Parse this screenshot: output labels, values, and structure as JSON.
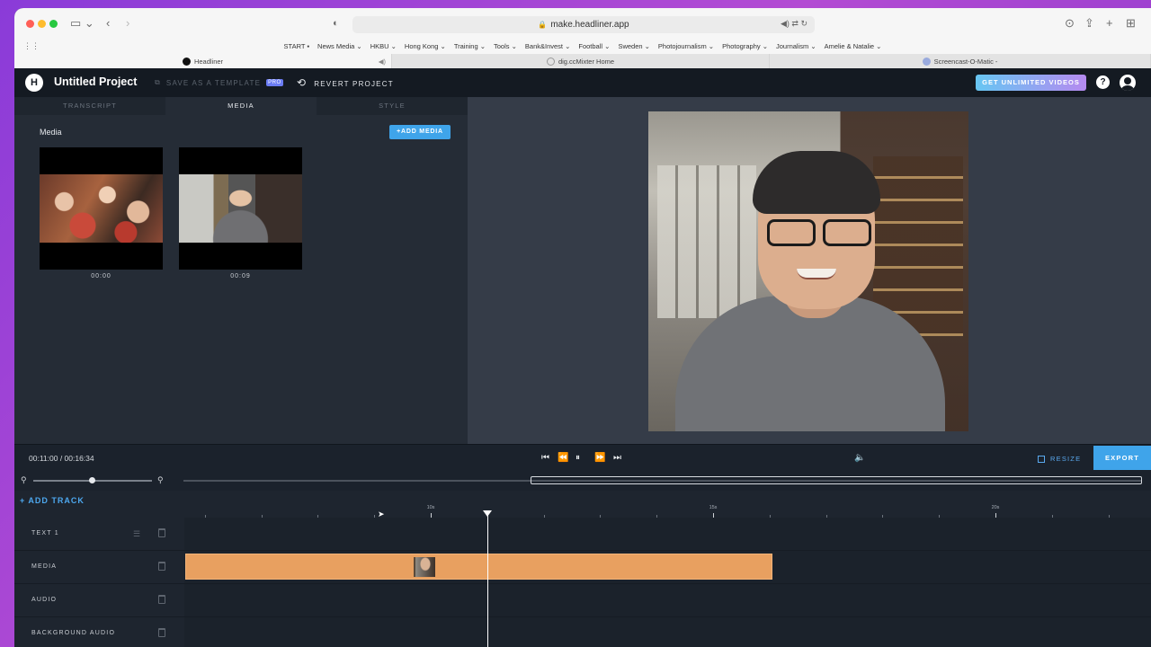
{
  "browser": {
    "url": "make.headliner.app",
    "favorites": [
      "START ▪",
      "News Media ⌄",
      "HKBU ⌄",
      "Hong Kong ⌄",
      "Training ⌄",
      "Tools ⌄",
      "Bank&Invest ⌄",
      "Football ⌄",
      "Sweden ⌄",
      "Photojournalism ⌄",
      "Photography ⌄",
      "Journalism ⌄",
      "Amelie & Natalie ⌄"
    ],
    "tabs": [
      {
        "label": "Headliner",
        "active": true
      },
      {
        "label": "dig.ccMixter Home",
        "active": false
      },
      {
        "label": "Screencast-O-Matic -",
        "active": false
      }
    ]
  },
  "app": {
    "logo_letter": "H",
    "project_title": "Untitled Project",
    "save_template_label": "SAVE AS A TEMPLATE",
    "pro_badge": "PRO",
    "revert_label": "REVERT PROJECT",
    "get_unlimited_label": "GET UNLIMITED VIDEOS",
    "help_label": "?"
  },
  "panel": {
    "tabs": [
      "TRANSCRIPT",
      "MEDIA",
      "STYLE"
    ],
    "active_tab": "MEDIA",
    "media_heading": "Media",
    "add_media_label": "+ADD MEDIA",
    "thumbnails": [
      {
        "time": "00:00"
      },
      {
        "time": "00:09"
      }
    ]
  },
  "playback": {
    "timecode": "00:11:00 / 00:16:34",
    "resize_label": "RESIZE",
    "export_label": "EXPORT"
  },
  "timeline": {
    "add_track_label": "+ ADD TRACK",
    "ruler_labels": [
      {
        "label": "10s",
        "sec": 10
      },
      {
        "label": "15s",
        "sec": 15
      },
      {
        "label": "20s",
        "sec": 20
      }
    ],
    "playhead_sec": 11.0,
    "tracks": [
      {
        "name": "TEXT 1"
      },
      {
        "name": "MEDIA"
      },
      {
        "name": "AUDIO"
      },
      {
        "name": "BACKGROUND AUDIO"
      }
    ]
  },
  "colors": {
    "accent": "#3fa4ea",
    "clip": "#e8a060"
  }
}
